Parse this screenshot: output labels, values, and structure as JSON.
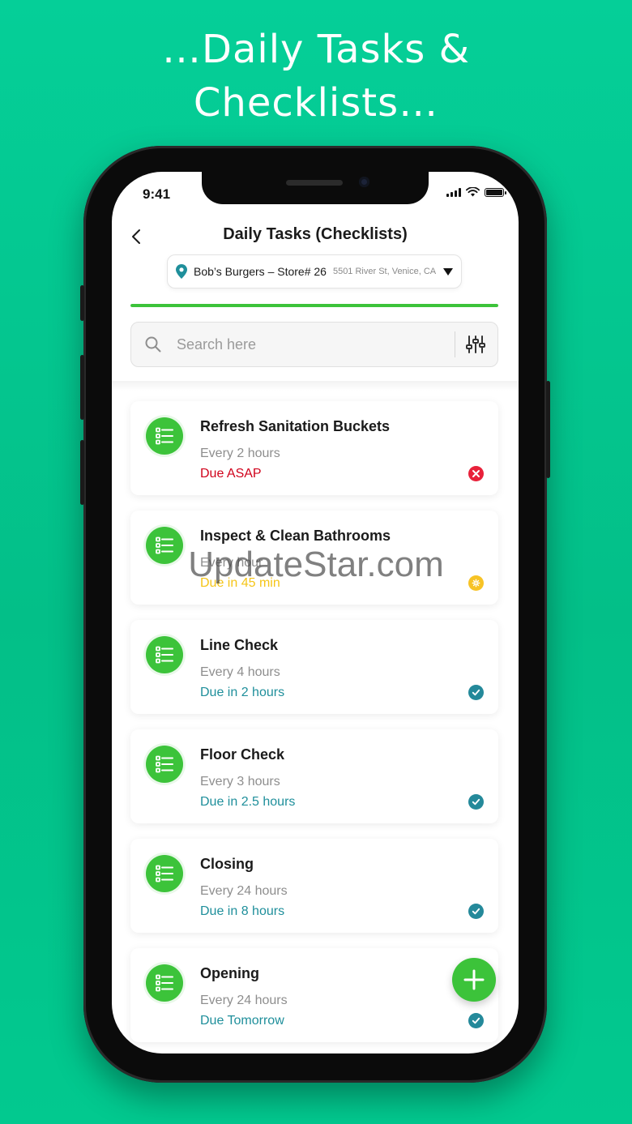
{
  "headline": {
    "line1": "…Daily Tasks &",
    "line2": "Checklists…"
  },
  "status_bar": {
    "time": "9:41"
  },
  "header": {
    "title": "Daily Tasks (Checklists)"
  },
  "store": {
    "name": "Bob’s Burgers – Store# 26",
    "address": "5501 River St, Venice, CA"
  },
  "progress": {
    "fraction": 1.0
  },
  "search": {
    "placeholder": "Search here"
  },
  "colors": {
    "brand_green": "#3cc33a",
    "due_asap": "#d0021b",
    "due_soon": "#f5c518",
    "due_ok": "#1f8f9b",
    "status_late": "#e8213a",
    "status_soon": "#f7c325",
    "status_ok": "#24899a"
  },
  "tasks": [
    {
      "title": "Refresh Sanitation Buckets",
      "frequency": "Every 2 hours",
      "due": "Due ASAP",
      "status": "overdue",
      "status_icon": "x-circle-icon"
    },
    {
      "title": "Inspect & Clean Bathrooms",
      "frequency": "Every hour",
      "due": "Due in 45 min",
      "status": "soon",
      "status_icon": "pending-circle-icon"
    },
    {
      "title": "Line Check",
      "frequency": "Every 4 hours",
      "due": "Due in 2 hours",
      "status": "ok",
      "status_icon": "check-circle-icon"
    },
    {
      "title": "Floor Check",
      "frequency": "Every 3 hours",
      "due": "Due in 2.5 hours",
      "status": "ok",
      "status_icon": "check-circle-icon"
    },
    {
      "title": "Closing",
      "frequency": "Every 24 hours",
      "due": "Due in 8 hours",
      "status": "ok",
      "status_icon": "check-circle-icon"
    },
    {
      "title": "Opening",
      "frequency": "Every 24 hours",
      "due": "Due Tomorrow",
      "status": "ok",
      "status_icon": "check-circle-icon"
    }
  ],
  "watermark": "UpdateStar.com"
}
